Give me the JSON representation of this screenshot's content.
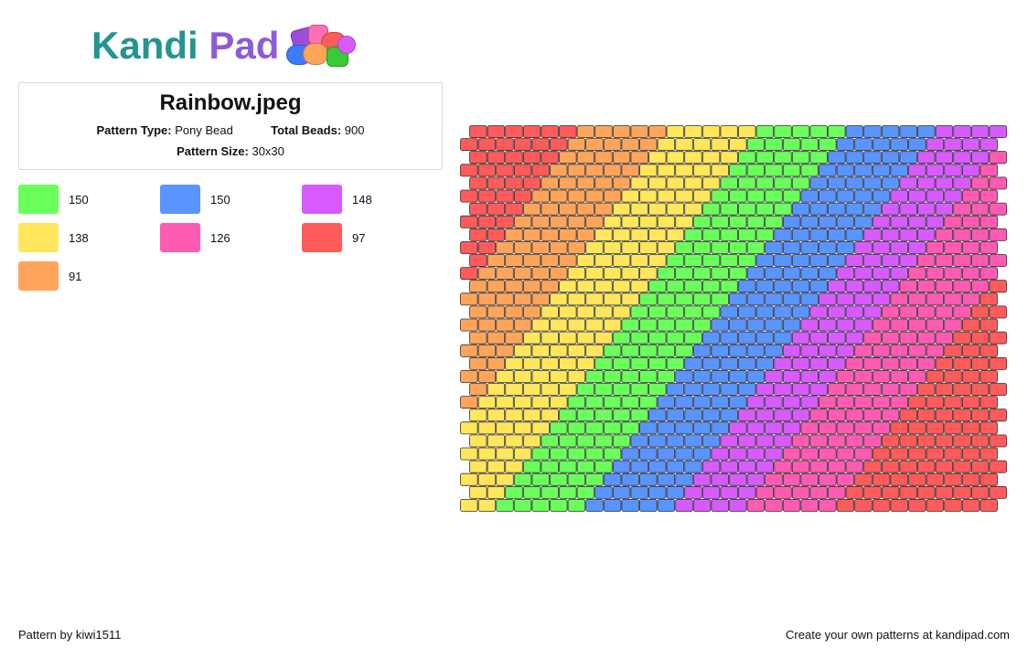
{
  "logo": {
    "part1": "Kandi",
    "part2": "Pad"
  },
  "pattern": {
    "title": "Rainbow.jpeg",
    "type_label": "Pattern Type:",
    "type_value": "Pony Bead",
    "beads_label": "Total Beads:",
    "beads_value": "900",
    "size_label": "Pattern Size:",
    "size_value": "30x30"
  },
  "legend": [
    {
      "color": "#6aff5b",
      "count": "150"
    },
    {
      "color": "#5a94ff",
      "count": "150"
    },
    {
      "color": "#d75bff",
      "count": "148"
    },
    {
      "color": "#ffe65b",
      "count": "138"
    },
    {
      "color": "#ff5bb3",
      "count": "126"
    },
    {
      "color": "#ff5b5b",
      "count": "97"
    },
    {
      "color": "#ffa55b",
      "count": "91"
    }
  ],
  "grid": {
    "rows": 30,
    "cols": 30
  },
  "footer": {
    "credit": "Pattern by kiwi1511",
    "cta": "Create your own patterns at kandipad.com"
  }
}
